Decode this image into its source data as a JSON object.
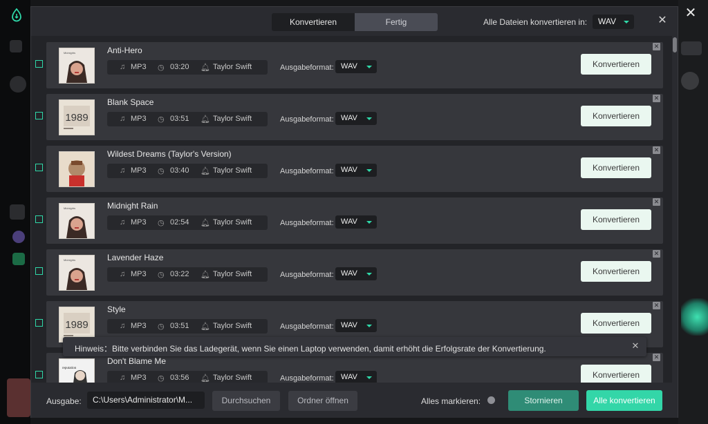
{
  "header": {
    "tabs": [
      {
        "label": "Konvertieren",
        "active": true
      },
      {
        "label": "Fertig",
        "active": false
      }
    ],
    "convert_all_label": "Alle Dateien konvertieren in:",
    "convert_all_format": "WAV"
  },
  "tracks": [
    {
      "title": "Anti-Hero",
      "format": "MP3",
      "duration": "03:20",
      "artist": "Taylor Swift",
      "output_label": "Ausgabeformat:",
      "output_format": "WAV",
      "button": "Konvertieren",
      "cover": "midnights"
    },
    {
      "title": "Blank Space",
      "format": "MP3",
      "duration": "03:51",
      "artist": "Taylor Swift",
      "output_label": "Ausgabeformat:",
      "output_format": "WAV",
      "button": "Konvertieren",
      "cover": "1989"
    },
    {
      "title": "Wildest Dreams (Taylor's Version)",
      "format": "MP3",
      "duration": "03:40",
      "artist": "Taylor Swift",
      "output_label": "Ausgabeformat:",
      "output_format": "WAV",
      "button": "Konvertieren",
      "cover": "1989tv"
    },
    {
      "title": "Midnight Rain",
      "format": "MP3",
      "duration": "02:54",
      "artist": "Taylor Swift",
      "output_label": "Ausgabeformat:",
      "output_format": "WAV",
      "button": "Konvertieren",
      "cover": "midnights"
    },
    {
      "title": "Lavender Haze",
      "format": "MP3",
      "duration": "03:22",
      "artist": "Taylor Swift",
      "output_label": "Ausgabeformat:",
      "output_format": "WAV",
      "button": "Konvertieren",
      "cover": "midnights"
    },
    {
      "title": "Style",
      "format": "MP3",
      "duration": "03:51",
      "artist": "Taylor Swift",
      "output_label": "Ausgabeformat:",
      "output_format": "WAV",
      "button": "Konvertieren",
      "cover": "1989"
    },
    {
      "title": "Don't Blame Me",
      "format": "MP3",
      "duration": "03:56",
      "artist": "Taylor Swift",
      "output_label": "Ausgabeformat:",
      "output_format": "WAV",
      "button": "Konvertieren",
      "cover": "reputation"
    }
  ],
  "cover_text": {
    "midnights": "Midnights",
    "1989": "1989",
    "reputation": "reputation"
  },
  "toast": {
    "text": "Hinweis：Bitte verbinden Sie das Ladegerät, wenn Sie einen Laptop verwenden, damit erhöht die Erfolgsrate der Konvertierung."
  },
  "footer": {
    "output_label": "Ausgabe:",
    "output_path": "C:\\Users\\Administrator\\M...",
    "browse": "Durchsuchen",
    "open_folder": "Ordner öffnen",
    "mark_all": "Alles markieren:",
    "cancel": "Stornieren",
    "convert_all": "Alle konvertieren"
  },
  "colors": {
    "accent": "#33d6a8",
    "cancel": "#2f8c76",
    "convert_button_bg": "#eaf7f0"
  }
}
